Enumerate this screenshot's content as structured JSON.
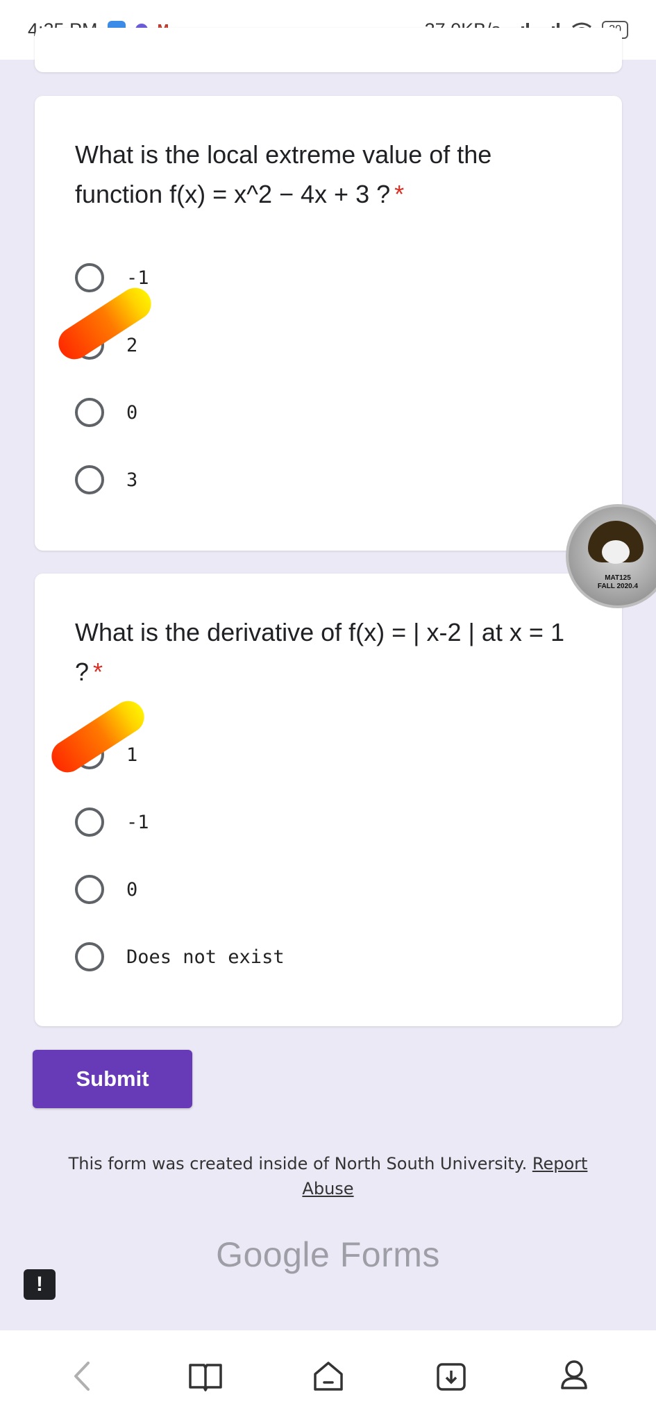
{
  "status_bar": {
    "time": "4:25 PM",
    "network_speed": "37.0KB/s",
    "battery": "30"
  },
  "questions": [
    {
      "title": "What is the local extreme value of the function f(x) = x^2 − 4x + 3 ?",
      "required_mark": "*",
      "options": [
        "-1",
        "2",
        "0",
        "3"
      ]
    },
    {
      "title": "What is the derivative of f(x) = | x-2 | at x = 1 ?",
      "required_mark": "*",
      "options": [
        "1",
        "-1",
        "0",
        "Does not exist"
      ]
    }
  ],
  "submit_label": "Submit",
  "footer": {
    "text": "This form was created inside of North South University.",
    "report_link": "Report Abuse"
  },
  "logo": "Google Forms",
  "badge": {
    "line1": "MAT125",
    "line2": "FALL 2020.4"
  },
  "alert_icon": "!",
  "icons": {
    "nav": [
      "back-icon",
      "book-icon",
      "home-icon",
      "download-icon",
      "profile-icon"
    ]
  },
  "colors": {
    "accent": "#673ab7",
    "background": "#ece9f6",
    "required": "#d93025"
  }
}
